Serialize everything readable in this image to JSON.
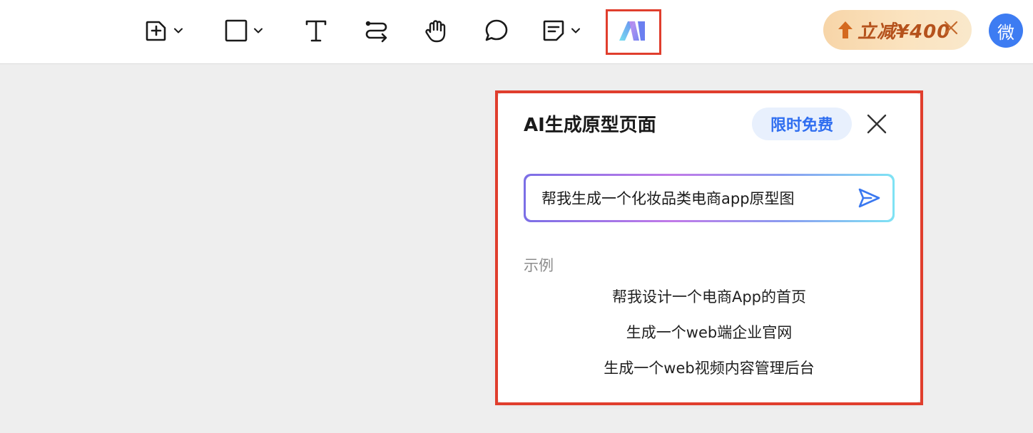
{
  "toolbar": {
    "tools": [
      {
        "name": "add-page",
        "icon": "add-page-icon",
        "has_dropdown": true
      },
      {
        "name": "rectangle",
        "icon": "rectangle-icon",
        "has_dropdown": true
      },
      {
        "name": "text",
        "icon": "text-icon",
        "has_dropdown": false
      },
      {
        "name": "connector",
        "icon": "connector-icon",
        "has_dropdown": false
      },
      {
        "name": "hand",
        "icon": "hand-icon",
        "has_dropdown": false
      },
      {
        "name": "comment",
        "icon": "comment-bubble-icon",
        "has_dropdown": false
      },
      {
        "name": "note",
        "icon": "note-icon",
        "has_dropdown": true
      },
      {
        "name": "ai-generate",
        "icon": "ai-logo-icon",
        "has_dropdown": false,
        "highlighted": true
      }
    ],
    "promo": {
      "text": "立减¥400",
      "icon": "arrow-up-icon"
    },
    "avatar": {
      "initial": "微",
      "color": "#3d7cf2"
    }
  },
  "panel": {
    "title": "AI生成原型页面",
    "badge": "限时免费",
    "prompt": {
      "value": "帮我生成一个化妆品类电商app原型图",
      "placeholder": ""
    },
    "examples_label": "示例",
    "examples": [
      "帮我设计一个电商App的首页",
      "生成一个web端企业官网",
      "生成一个web视频内容管理后台"
    ]
  },
  "colors": {
    "highlight_border": "#e03e2d",
    "accent_blue": "#2f6ef0",
    "badge_bg": "#e8f0fd",
    "promo_text": "#b5521c",
    "canvas_bg": "#eeeeee"
  }
}
